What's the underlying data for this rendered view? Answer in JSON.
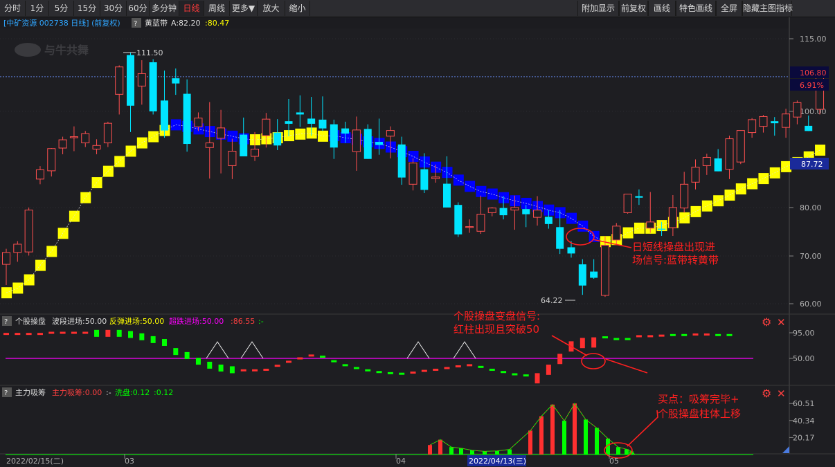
{
  "toolbar": {
    "left": [
      "分时",
      "1分",
      "5分",
      "15分",
      "30分",
      "60分",
      "多分钟",
      "日线",
      "周线",
      "更多▼",
      "放大",
      "缩小"
    ],
    "active": "日线",
    "right": [
      "附加显示",
      "前复权",
      "画线",
      "特色画线",
      "全屏",
      "隐藏主图指标"
    ]
  },
  "colors": {
    "up": "#ff3030",
    "up_hollow": "#ff5050",
    "down": "#00e5ff",
    "band_yellow": "#ffff00",
    "band_blue": "#0000ff",
    "accent_magenta": "#ff00ff",
    "green": "#00ff00",
    "annotation": "#ff2020"
  },
  "main_panel": {
    "stock_title": "[中矿资源 002738 日线] (前复权)",
    "help": "?",
    "indicator_name": "黄蓝带",
    "ind_a": "A:82.20",
    "ind_b": ":80.47",
    "logo_text": "与牛共舞",
    "high_label": "111.50",
    "low_label": "64.22",
    "y_ticks": [
      "115.00",
      "100.00",
      "80.00",
      "70.00",
      "60.00"
    ],
    "price_tag": "106.80",
    "pct_tag": "6.91%",
    "cursor_tag": "87.72",
    "annotation": [
      "日短线操盘出现进",
      "场信号:蓝带转黄带"
    ]
  },
  "panel2": {
    "name": "个股操盘",
    "l1": "波段进场:50.00",
    "l2": "反弹进场:50.00",
    "l3": "超跌进场:50.00",
    "l4": ":86.55",
    "l5": ":-",
    "y_ticks": [
      "95.00",
      "50.00"
    ],
    "annotation": [
      "个股操盘变盘信号:",
      "红柱出现且突破50"
    ]
  },
  "panel3": {
    "name": "主力吸筹",
    "l1": "主力吸筹:0.00",
    "l2": ":-",
    "l3": "洗盘:0.12",
    "l4": ":0.12",
    "y_ticks": [
      "60.51",
      "40.34",
      "20.17"
    ],
    "annotation": [
      "买点：吸筹完毕+",
      "个股操盘柱体上移"
    ]
  },
  "x_axis": {
    "labels": [
      "2022/02/15(二)",
      "03",
      "04",
      "2022/04/13(三)",
      "05"
    ]
  },
  "chart_data": {
    "type": "candlestick",
    "candles": [
      [
        70.5,
        73.5,
        66.5,
        72.8
      ],
      [
        72.8,
        75.0,
        71.0,
        74.4
      ],
      [
        72.9,
        81.5,
        72.2,
        81.0
      ],
      [
        87.0,
        89.5,
        86.0,
        88.8
      ],
      [
        88.6,
        93.0,
        87.5,
        92.9
      ],
      [
        93.0,
        95.2,
        91.8,
        94.6
      ],
      [
        95.0,
        97.2,
        92.4,
        95.2
      ],
      [
        94.0,
        96.3,
        93.2,
        95.8
      ],
      [
        92.8,
        94.7,
        91.8,
        93.5
      ],
      [
        94.0,
        98.1,
        93.2,
        97.8
      ],
      [
        103.4,
        109.0,
        99.5,
        108.7
      ],
      [
        111.0,
        111.5,
        96.1,
        101.2
      ],
      [
        105.0,
        110.0,
        101.4,
        107.4
      ],
      [
        109.6,
        110.2,
        99.5,
        100.1
      ],
      [
        102.2,
        108.0,
        95.0,
        96.4
      ],
      [
        106.5,
        108.4,
        103.3,
        105.5
      ],
      [
        103.5,
        106.3,
        92.3,
        93.8
      ],
      [
        97.1,
        99.9,
        96.3,
        98.8
      ],
      [
        93.1,
        101.9,
        87.1,
        94.0
      ],
      [
        94.9,
        100.4,
        88.1,
        96.9
      ],
      [
        89.6,
        94.8,
        87.0,
        92.4
      ],
      [
        95.6,
        98.9,
        91.4,
        91.4
      ],
      [
        91.4,
        96.1,
        90.5,
        92.8
      ],
      [
        95.4,
        99.8,
        93.1,
        98.6
      ],
      [
        96.0,
        98.6,
        92.6,
        93.5
      ],
      [
        98.2,
        102.5,
        95.3,
        97.7
      ],
      [
        99.9,
        103.2,
        97.1,
        99.5
      ],
      [
        98.7,
        102.9,
        95.4,
        97.7
      ],
      [
        98.5,
        103.0,
        96.3,
        96.8
      ],
      [
        97.6,
        98.5,
        90.9,
        93.1
      ],
      [
        96.8,
        98.1,
        94.0,
        95.8
      ],
      [
        92.3,
        99.1,
        88.6,
        96.5
      ],
      [
        96.7,
        97.6,
        90.9,
        90.9
      ],
      [
        94.2,
        98.7,
        91.7,
        93.6
      ],
      [
        95.3,
        97.2,
        91.0,
        96.4
      ],
      [
        93.7,
        95.2,
        85.9,
        87.3
      ],
      [
        86.0,
        91.0,
        84.8,
        90.1
      ],
      [
        88.9,
        92.0,
        84.3,
        84.9
      ],
      [
        87.1,
        89.8,
        86.3,
        87.4
      ],
      [
        86.1,
        91.4,
        82.3,
        81.5
      ],
      [
        82.0,
        82.5,
        75.8,
        76.3
      ],
      [
        77.8,
        79.2,
        76.6,
        77.8
      ],
      [
        76.9,
        83.8,
        76.4,
        80.2
      ],
      [
        80.5,
        81.6,
        79.8,
        81.4
      ],
      [
        81.4,
        83.7,
        79.2,
        80.0
      ],
      [
        81.0,
        83.8,
        77.2,
        81.5
      ],
      [
        81.2,
        82.0,
        77.7,
        80.2
      ],
      [
        79.6,
        83.7,
        78.0,
        81.0
      ],
      [
        79.7,
        81.0,
        77.4,
        78.3
      ],
      [
        77.7,
        81.0,
        72.5,
        73.5
      ],
      [
        73.8,
        75.0,
        71.8,
        72.6
      ],
      [
        70.5,
        71.5,
        64.6,
        66.4
      ],
      [
        69.1,
        71.5,
        67.7,
        67.9
      ],
      [
        64.5,
        75.9,
        64.2,
        74.2
      ],
      [
        75.2,
        78.5,
        74.4,
        77.9
      ],
      [
        80.5,
        83.1,
        80.3,
        84.1
      ],
      [
        83.7,
        85.0,
        82.0,
        83.4
      ],
      [
        77.5,
        84.5,
        76.6,
        78.7
      ],
      [
        77.4,
        78.7,
        76.0,
        77.2
      ],
      [
        77.6,
        83.9,
        76.0,
        81.5
      ],
      [
        81.4,
        88.4,
        80.5,
        86.0
      ],
      [
        86.4,
        90.8,
        85.0,
        89.3
      ],
      [
        89.6,
        91.9,
        87.8,
        91.2
      ],
      [
        91.0,
        92.8,
        88.5,
        88.5
      ],
      [
        88.9,
        95.4,
        87.0,
        94.8
      ],
      [
        90.3,
        96.3,
        89.9,
        96.4
      ],
      [
        96.0,
        98.8,
        95.0,
        98.5
      ],
      [
        97.2,
        99.4,
        96.0,
        99.1
      ],
      [
        98.2,
        99.0,
        95.4,
        97.8
      ],
      [
        97.0,
        100.6,
        95.0,
        99.6
      ],
      [
        99.0,
        102.2,
        97.6,
        101.8
      ],
      [
        97.3,
        99.3,
        96.3,
        96.3
      ],
      [
        100.5,
        106.8,
        99.5,
        106.8
      ]
    ],
    "band": [
      [
        65.0,
        "y"
      ],
      [
        65.9,
        "y"
      ],
      [
        67.5,
        "y"
      ],
      [
        70.3,
        "y"
      ],
      [
        73.0,
        "y"
      ],
      [
        76.5,
        "y"
      ],
      [
        79.8,
        "y"
      ],
      [
        83.4,
        "y"
      ],
      [
        86.3,
        "y"
      ],
      [
        88.5,
        "y"
      ],
      [
        90.4,
        "y"
      ],
      [
        92.4,
        "y"
      ],
      [
        94.0,
        "y"
      ],
      [
        95.2,
        "y"
      ],
      [
        96.4,
        "y"
      ],
      [
        97.5,
        "b"
      ],
      [
        97.2,
        "b"
      ],
      [
        96.7,
        "b"
      ],
      [
        96.2,
        "b"
      ],
      [
        95.7,
        "b"
      ],
      [
        95.3,
        "b"
      ],
      [
        94.8,
        "b"
      ],
      [
        94.6,
        "y"
      ],
      [
        94.8,
        "y"
      ],
      [
        95.0,
        "y"
      ],
      [
        95.4,
        "y"
      ],
      [
        95.7,
        "y"
      ],
      [
        95.9,
        "y"
      ],
      [
        95.3,
        "y"
      ],
      [
        95.4,
        "b"
      ],
      [
        95.0,
        "b"
      ],
      [
        94.7,
        "b"
      ],
      [
        94.2,
        "b"
      ],
      [
        93.9,
        "b"
      ],
      [
        93.2,
        "b"
      ],
      [
        92.3,
        "b"
      ],
      [
        91.4,
        "b"
      ],
      [
        90.3,
        "b"
      ],
      [
        89.3,
        "b"
      ],
      [
        88.3,
        "b"
      ],
      [
        86.8,
        "b"
      ],
      [
        85.6,
        "b"
      ],
      [
        84.6,
        "b"
      ],
      [
        84.1,
        "b"
      ],
      [
        83.4,
        "b"
      ],
      [
        82.8,
        "b"
      ],
      [
        82.3,
        "b"
      ],
      [
        81.7,
        "b"
      ],
      [
        81.0,
        "b"
      ],
      [
        80.5,
        "b"
      ],
      [
        79.4,
        "b"
      ],
      [
        77.9,
        "b"
      ],
      [
        75.9,
        "b"
      ],
      [
        74.9,
        "y"
      ],
      [
        75.3,
        "y"
      ],
      [
        76.6,
        "y"
      ],
      [
        77.5,
        "y"
      ],
      [
        77.5,
        "y"
      ],
      [
        78.0,
        "y"
      ],
      [
        78.6,
        "y"
      ],
      [
        79.5,
        "y"
      ],
      [
        80.7,
        "y"
      ],
      [
        81.8,
        "y"
      ],
      [
        82.8,
        "y"
      ],
      [
        83.9,
        "y"
      ],
      [
        85.1,
        "y"
      ],
      [
        86.1,
        "y"
      ],
      [
        87.1,
        "y"
      ],
      [
        88.2,
        "y"
      ],
      [
        89.4,
        "y"
      ],
      [
        90.2,
        "y"
      ],
      [
        91.3,
        "y"
      ],
      [
        92.6,
        "y"
      ]
    ],
    "op_panel_values": [
      [
        93,
        "r"
      ],
      [
        93,
        "r"
      ],
      [
        93,
        "r"
      ],
      [
        93,
        "r"
      ],
      [
        95,
        "r"
      ],
      [
        95,
        "r"
      ],
      [
        95,
        "r"
      ],
      [
        95,
        "r"
      ],
      [
        94,
        "g"
      ],
      [
        94,
        "r"
      ],
      [
        94,
        "g"
      ],
      [
        92,
        "g"
      ],
      [
        88,
        "g"
      ],
      [
        83,
        "g"
      ],
      [
        78,
        "g"
      ],
      [
        62,
        "g"
      ],
      [
        55,
        "g"
      ],
      [
        45,
        "g"
      ],
      [
        38,
        "g"
      ],
      [
        33,
        "g"
      ],
      [
        30,
        "g"
      ],
      [
        29,
        "r"
      ],
      [
        29,
        "r"
      ],
      [
        30,
        "r"
      ],
      [
        37,
        "r"
      ],
      [
        44,
        "r"
      ],
      [
        50,
        "r"
      ],
      [
        55,
        "r"
      ],
      [
        53,
        "g"
      ],
      [
        45,
        "g"
      ],
      [
        38,
        "g"
      ],
      [
        33,
        "g"
      ],
      [
        29,
        "g"
      ],
      [
        26,
        "g"
      ],
      [
        24,
        "g"
      ],
      [
        23,
        "g"
      ],
      [
        25,
        "r"
      ],
      [
        28,
        "r"
      ],
      [
        30,
        "r"
      ],
      [
        33,
        "r"
      ],
      [
        36,
        "r"
      ],
      [
        38,
        "r"
      ],
      [
        35,
        "g"
      ],
      [
        30,
        "g"
      ],
      [
        26,
        "g"
      ],
      [
        22,
        "g"
      ],
      [
        20,
        "g"
      ],
      [
        24,
        "r"
      ],
      [
        39,
        "r"
      ],
      [
        58,
        "r"
      ],
      [
        80,
        "r"
      ],
      [
        86,
        "r"
      ],
      [
        87,
        "r"
      ],
      [
        87,
        "g"
      ],
      [
        84,
        "g"
      ],
      [
        84,
        "g"
      ],
      [
        89,
        "r"
      ],
      [
        89,
        "r"
      ],
      [
        90,
        "r"
      ],
      [
        91,
        "g"
      ],
      [
        91,
        "g"
      ],
      [
        92,
        "r"
      ],
      [
        92,
        "r"
      ],
      [
        91,
        "g"
      ],
      [
        91,
        "g"
      ]
    ],
    "absorb_panel_values": [
      [
        11.3,
        "r"
      ],
      [
        17.6,
        "r"
      ],
      [
        8.8,
        "g"
      ],
      [
        7.5,
        "g"
      ],
      [
        5.0,
        "g"
      ],
      [
        3.8,
        "g"
      ],
      [
        4.3,
        "g"
      ],
      [
        6.1,
        "g"
      ],
      [
        28.4,
        "r"
      ],
      [
        45.4,
        "r"
      ],
      [
        59.2,
        "r"
      ],
      [
        40.0,
        "g"
      ],
      [
        60.5,
        "r"
      ],
      [
        41.5,
        "g"
      ],
      [
        31.5,
        "g"
      ],
      [
        18.9,
        "g"
      ],
      [
        8.8,
        "g"
      ],
      [
        6.3,
        "g"
      ],
      [
        3.8,
        "g"
      ],
      [
        0.1,
        "g"
      ]
    ]
  }
}
